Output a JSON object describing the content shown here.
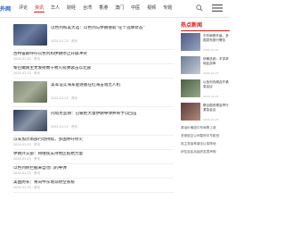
{
  "header": {
    "logo": "外网",
    "nav": [
      {
        "label": "评论",
        "active": false
      },
      {
        "label": "资讯",
        "active": true
      },
      {
        "label": "华人",
        "active": false
      },
      {
        "label": "财经",
        "active": false
      },
      {
        "label": "台湾",
        "active": false
      },
      {
        "label": "香港",
        "active": false
      },
      {
        "label": "澳门",
        "active": false
      },
      {
        "label": "中医",
        "active": false
      },
      {
        "label": "视频",
        "active": false
      },
      {
        "label": "专题",
        "active": false
      }
    ],
    "search_icon": "search-icon",
    "menu_icon": "menu-icon",
    "accent_color": "#d41c1c"
  },
  "feed": {
    "items": [
      {
        "title": "以色列和美大选：以色列与伊朗德就“在个选举状态”",
        "meta": "2024-01-23 · 资讯",
        "has_image": true
      },
      {
        "title": "古特雷斯呼吁以色列和伊朗停止升级冲突",
        "meta": "2024-01-23 · 资讯",
        "has_image": false
      },
      {
        "title": "黎巴嫩真主党发射数十枚火箭弹袭击以北部",
        "meta": "2024-01-23 · 资讯",
        "has_image": false
      },
      {
        "title": "美军证实海军驱逐舰在红海击落无人机",
        "meta": "2024-01-23 · 资讯",
        "has_image": true
      },
      {
        "title": "内塔尼亚胡：已被拒大量伊朗导弹并将予以回击",
        "meta": "2024-01-23 · 资讯",
        "has_image": true
      },
      {
        "title": "以军加沙南部行动持续，多国呼吁停火",
        "meta": "2024-01-23 · 资讯",
        "has_image": false
      },
      {
        "title": "伊朗外交部：将继续支持地区抵抗力量",
        "meta": "2024-01-23 · 资讯",
        "has_image": false
      },
      {
        "title": "以色列称拦截来自也门的导弹",
        "meta": "2024-01-23 · 资讯",
        "has_image": false
      },
      {
        "title": "美国防长：将向中东增派防空系统",
        "meta": "2024-01-23 · 资讯",
        "has_image": false
      }
    ]
  },
  "sidebar": {
    "header": "热点新闻",
    "items": [
      {
        "title": "中东局势升级，多国发布旅行警告",
        "meta": "2024-01-23"
      },
      {
        "title": "伊朗总统：不寻求地区战争",
        "meta": "2024-01-23"
      },
      {
        "title": "以色列内阁召开紧急会议",
        "meta": "2024-01-23"
      },
      {
        "title": "联合国安理会举行紧急会议",
        "meta": "2024-01-23"
      }
    ],
    "links": [
      "原油价格因中东局势上涨",
      "多家航空公司暂停中东航班",
      "真主党宣称袭击以军阵地",
      "伊拉克民兵组织发表声明"
    ]
  }
}
